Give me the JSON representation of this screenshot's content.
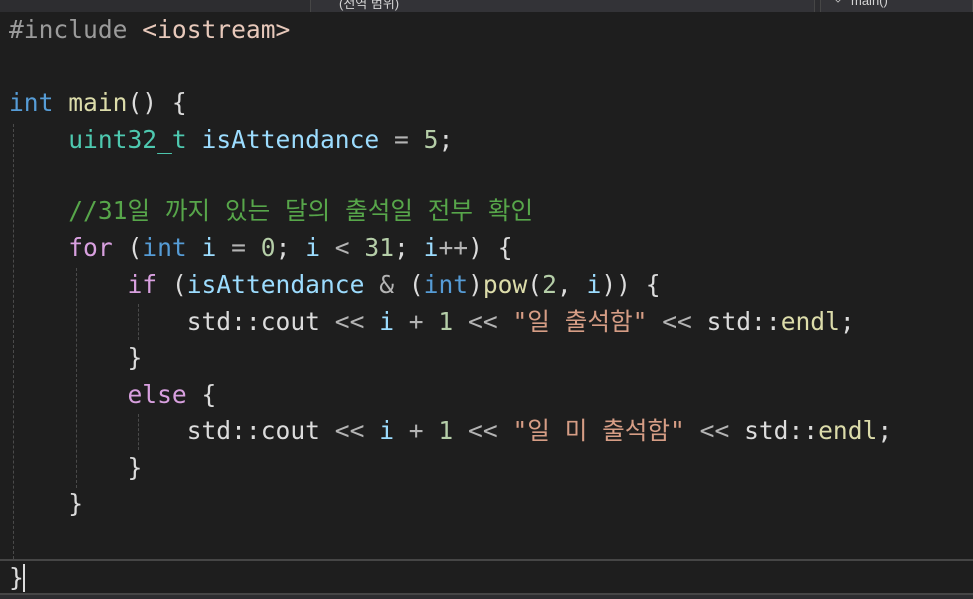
{
  "nav_bar": {
    "scope_dropdown": "(전역 범위)",
    "function_dropdown": "main()"
  },
  "code": {
    "line1": {
      "pp": "#include",
      "header": " <iostream>"
    },
    "line3": {
      "kw": "int",
      "fn": " main",
      "rest": "() {"
    },
    "line4": {
      "type": "uint32_t",
      "var": " isAttendance",
      "op": " = ",
      "num": "5",
      "end": ";"
    },
    "line6": {
      "comment": "//31일 까지 있는 달의 출석일 전부 확인"
    },
    "line7": {
      "ctl": "for",
      "p1": " (",
      "kw": "int",
      "var1": " i",
      "op1": " = ",
      "num1": "0",
      "semi1": "; ",
      "var2": "i",
      "op2": " < ",
      "num2": "31",
      "semi2": "; ",
      "var3": "i",
      "op3": "++",
      "end": ") {"
    },
    "line8": {
      "ctl": "if",
      "p1": " (",
      "var": "isAttendance",
      "op": " & ",
      "p2": "(",
      "kw": "int",
      "p3": ")",
      "fn": "pow",
      "p4": "(",
      "num": "2",
      "comma": ", ",
      "var2": "i",
      "end": ")) {"
    },
    "line9": {
      "ns": "std::cout",
      "op1": " << ",
      "var": "i",
      "op2": " + ",
      "num": "1",
      "op3": " << ",
      "str": "\"일 출석함\"",
      "op4": " << ",
      "ns2": "std::",
      "fn": "endl",
      "end": ";"
    },
    "line10": {
      "brace": "}"
    },
    "line11": {
      "ctl": "else",
      "end": " {"
    },
    "line12": {
      "ns": "std::cout",
      "op1": " << ",
      "var": "i",
      "op2": " + ",
      "num": "1",
      "op3": " << ",
      "str": "\"일 미 출석함\"",
      "op4": " << ",
      "ns2": "std::",
      "fn": "endl",
      "end": ";"
    },
    "line13": {
      "brace": "}"
    },
    "line14": {
      "brace": "}"
    },
    "line16": {
      "brace": "}"
    }
  }
}
